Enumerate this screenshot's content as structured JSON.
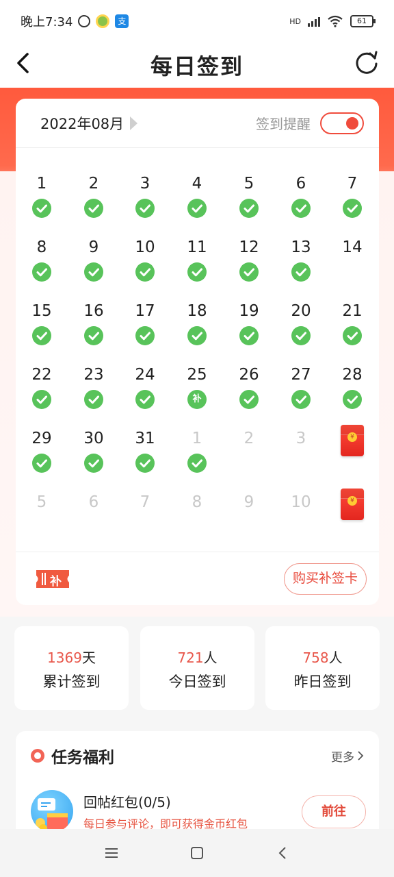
{
  "status_bar": {
    "time": "晚上7:34",
    "app_icon_b": "支",
    "network": "HD",
    "battery": "61"
  },
  "header": {
    "title": "每日签到"
  },
  "calendar": {
    "month": "2022年08月",
    "reminder_label": "签到提醒",
    "reminder_on": true,
    "weeks": [
      [
        {
          "n": "1",
          "state": "checked"
        },
        {
          "n": "2",
          "state": "checked"
        },
        {
          "n": "3",
          "state": "checked"
        },
        {
          "n": "4",
          "state": "checked"
        },
        {
          "n": "5",
          "state": "checked"
        },
        {
          "n": "6",
          "state": "checked"
        },
        {
          "n": "7",
          "state": "checked"
        }
      ],
      [
        {
          "n": "8",
          "state": "checked"
        },
        {
          "n": "9",
          "state": "checked"
        },
        {
          "n": "10",
          "state": "checked"
        },
        {
          "n": "11",
          "state": "checked"
        },
        {
          "n": "12",
          "state": "checked"
        },
        {
          "n": "13",
          "state": "checked"
        },
        {
          "n": "14",
          "state": "none"
        }
      ],
      [
        {
          "n": "15",
          "state": "checked"
        },
        {
          "n": "16",
          "state": "checked"
        },
        {
          "n": "17",
          "state": "checked"
        },
        {
          "n": "18",
          "state": "checked"
        },
        {
          "n": "19",
          "state": "checked"
        },
        {
          "n": "20",
          "state": "checked"
        },
        {
          "n": "21",
          "state": "checked"
        }
      ],
      [
        {
          "n": "22",
          "state": "checked"
        },
        {
          "n": "23",
          "state": "checked"
        },
        {
          "n": "24",
          "state": "checked"
        },
        {
          "n": "25",
          "state": "makeup"
        },
        {
          "n": "26",
          "state": "checked"
        },
        {
          "n": "27",
          "state": "checked"
        },
        {
          "n": "28",
          "state": "checked"
        }
      ],
      [
        {
          "n": "29",
          "state": "checked"
        },
        {
          "n": "30",
          "state": "checked"
        },
        {
          "n": "31",
          "state": "checked"
        },
        {
          "n": "1",
          "state": "other-checked"
        },
        {
          "n": "2",
          "state": "other"
        },
        {
          "n": "3",
          "state": "other"
        },
        {
          "n": "",
          "state": "redpacket"
        }
      ],
      [
        {
          "n": "5",
          "state": "other"
        },
        {
          "n": "6",
          "state": "other"
        },
        {
          "n": "7",
          "state": "other"
        },
        {
          "n": "8",
          "state": "other"
        },
        {
          "n": "9",
          "state": "other"
        },
        {
          "n": "10",
          "state": "other"
        },
        {
          "n": "",
          "state": "redpacket"
        }
      ]
    ],
    "makeup_mark": "补",
    "card_icon_text": "补",
    "buy_button": "购买补签卡"
  },
  "stats": [
    {
      "value": "1369",
      "unit": "天",
      "label": "累计签到"
    },
    {
      "value": "721",
      "unit": "人",
      "label": "今日签到"
    },
    {
      "value": "758",
      "unit": "人",
      "label": "昨日签到"
    }
  ],
  "tasks": {
    "title": "任务福利",
    "more": "更多",
    "items": [
      {
        "name": "回帖红包(0/5)",
        "desc": "每日参与评论，即可获得金币红包",
        "button": "前往"
      }
    ]
  },
  "colors": {
    "accent_red": "#f04b3c",
    "check_green": "#58c35a"
  }
}
